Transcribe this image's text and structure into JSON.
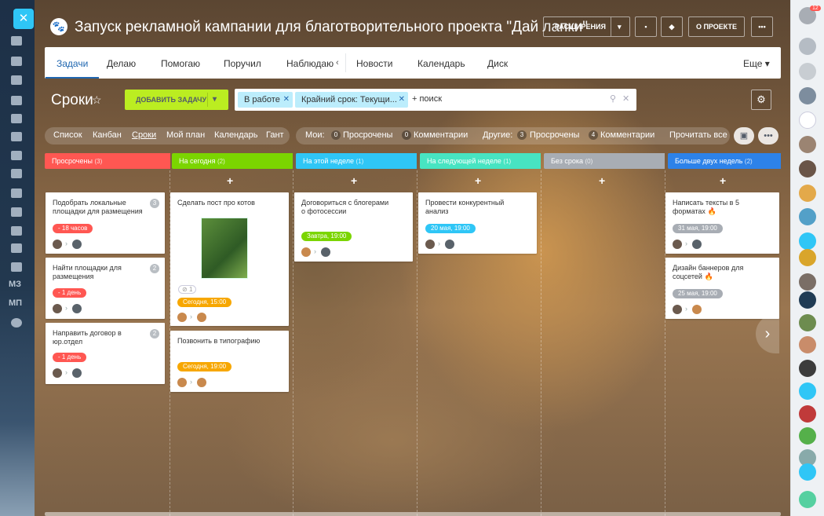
{
  "left_sidebar": {
    "labels": [
      "МЗ",
      "МП"
    ],
    "badge": "2"
  },
  "right_sidebar": {
    "notif_count": "12"
  },
  "header": {
    "title": "Запуск рекламной кампании для благотворительного проекта \"Дай лапки\"",
    "extensions": "РАСШИРЕНИЯ",
    "about": "О ПРОЕКТЕ",
    "more": "•••"
  },
  "tabs": [
    "Задачи",
    "Делаю",
    "Помогаю",
    "Поручил",
    "Наблюдаю",
    "Новости",
    "Календарь",
    "Диск",
    "Еще"
  ],
  "page": {
    "title": "Сроки",
    "add_task": "ДОБАВИТЬ ЗАДАЧУ",
    "filter_chips": [
      "В работе",
      "Крайний срок: Текущи..."
    ],
    "search_placeholder": "+ поиск"
  },
  "views": [
    "Список",
    "Канбан",
    "Сроки",
    "Мой план",
    "Календарь",
    "Гант"
  ],
  "counters": {
    "mine_label": "Мои:",
    "mine_overdue_count": "0",
    "mine_overdue": "Просрочены",
    "mine_comments_count": "0",
    "mine_comments": "Комментарии",
    "others_label": "Другие:",
    "others_overdue_count": "3",
    "others_overdue": "Просрочены",
    "others_comments_count": "4",
    "others_comments": "Комментарии",
    "read_all": "Прочитать все"
  },
  "stages": [
    {
      "name": "Просрочены",
      "count": "(3)",
      "color": "#ff5752"
    },
    {
      "name": "На сегодня",
      "count": "(2)",
      "color": "#7bd500"
    },
    {
      "name": "На этой неделе",
      "count": "(1)",
      "color": "#2fc6f6"
    },
    {
      "name": "На следующей неделе",
      "count": "(1)",
      "color": "#47e4c2"
    },
    {
      "name": "Без срока",
      "count": "(0)",
      "color": "#a8adb4"
    },
    {
      "name": "Больше двух недель",
      "count": "(2)",
      "color": "#2d82e9"
    }
  ],
  "cards": {
    "c1": {
      "title": "Подобрать локальные площадки для размещения",
      "badge": "3",
      "deadline": "- 18 часов"
    },
    "c2": {
      "title": "Найти площадки для размещения",
      "badge": "2",
      "deadline": "- 1 день"
    },
    "c3": {
      "title": "Направить договор в юр.отдел",
      "badge": "2",
      "deadline": "- 1 день"
    },
    "c4": {
      "title": "Сделать пост про котов",
      "attach": "1",
      "deadline": "Сегодня, 15:00"
    },
    "c5": {
      "title": "Позвонить в типографию",
      "deadline": "Сегодня, 19:00"
    },
    "c6": {
      "title": "Договориться с блогерами о фотосессии",
      "deadline": "Завтра, 19:00"
    },
    "c7": {
      "title": "Провести конкурентный анализ",
      "deadline": "20 мая, 19:00"
    },
    "c8": {
      "title": "Написать тексты в 5 форматах",
      "deadline": "31 мая, 19:00"
    },
    "c9": {
      "title": "Дизайн баннеров для соцсетей",
      "deadline": "25 мая, 19:00"
    }
  },
  "colors": {
    "overdue": "#ff5752",
    "today": "#f7a700",
    "tomorrow": "#7bd500",
    "future": "#2fc6f6",
    "neutral": "#a8adb4",
    "accent": "#2067b0"
  }
}
